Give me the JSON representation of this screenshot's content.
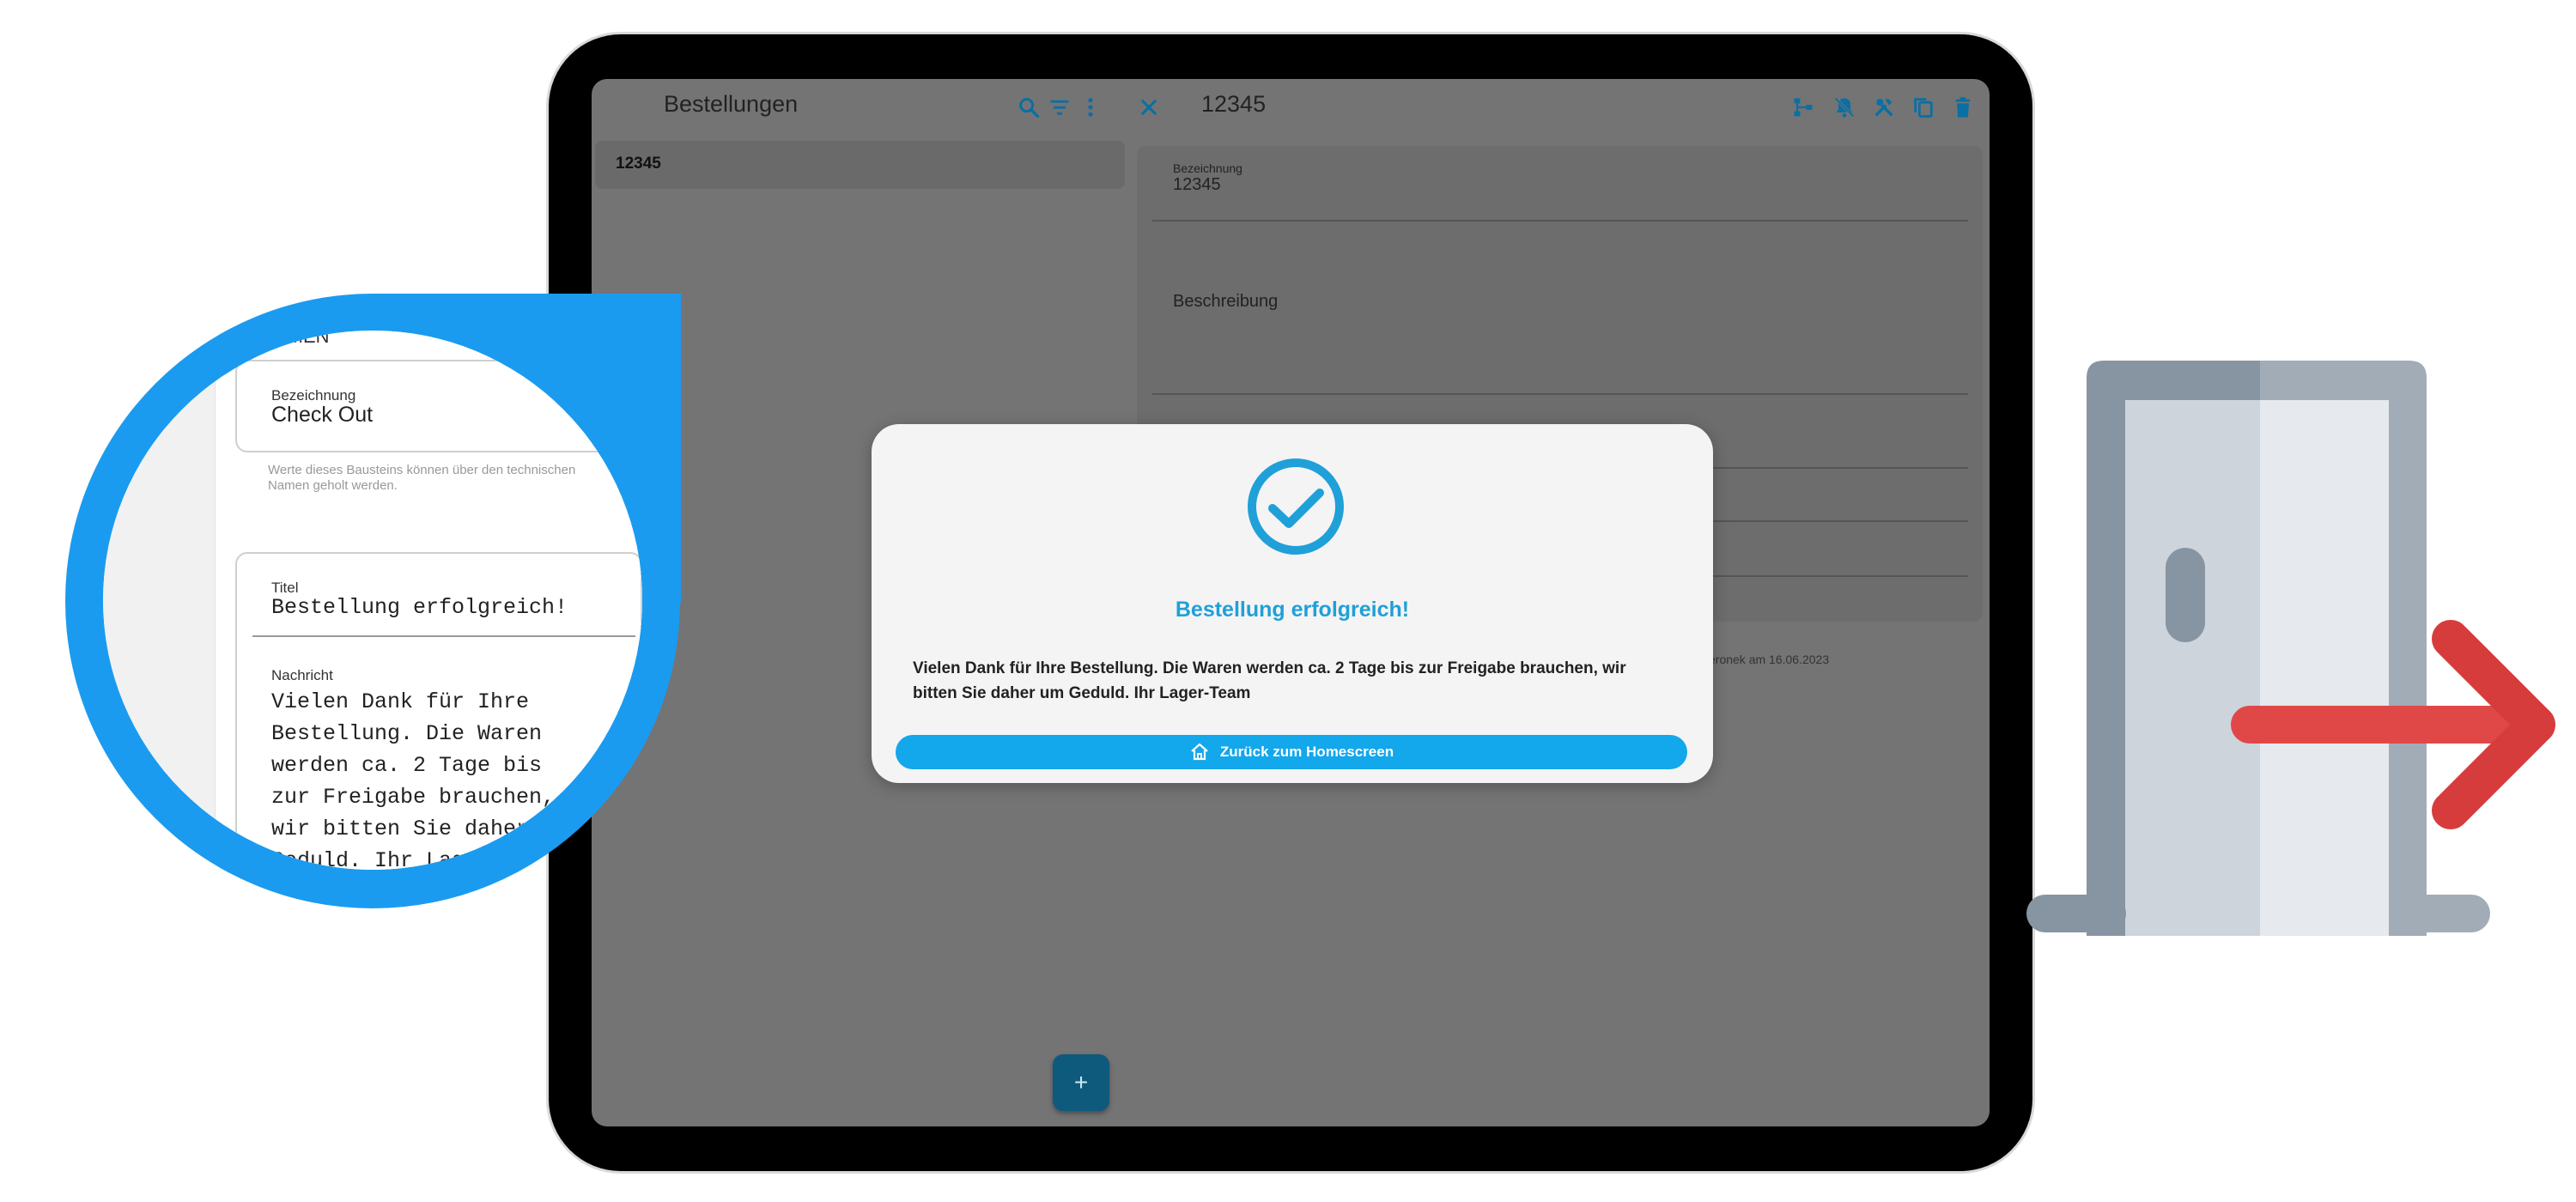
{
  "list": {
    "title": "Bestellungen",
    "items": [
      "12345"
    ]
  },
  "detail": {
    "title": "12345",
    "bezeichnung_label": "Bezeichnung",
    "bezeichnung_value": "12345",
    "beschreibung_label": "Beschreibung",
    "meta_text": "eronek am 16.06.2023"
  },
  "fab": {
    "label": "+"
  },
  "dialog": {
    "title": "Bestellung erfolgreich!",
    "message": "Vielen Dank für Ihre Bestellung. Die Waren werden ca. 2 Tage bis zur Freigabe brauchen, wir bitten Sie daher um Geduld. Ihr Lager-Team",
    "button_label": "Zurück zum Homescreen",
    "button_icon": "home-icon"
  },
  "magnifier": {
    "section_fragment": "AMEN",
    "bezeichnung_label": "Bezeichnung",
    "bezeichnung_value": "Check Out",
    "help_text": "Werte dieses Bausteins können über den technischen Namen geholt werden.",
    "titel_label": "Titel",
    "titel_value": "Bestellung erfolgreich!",
    "nachricht_label": "Nachricht",
    "nachricht_lines": [
      "Vielen Dank für Ihre",
      "Bestellung. Die Waren",
      "werden ca. 2 Tage bis",
      "zur Freigabe brauchen,",
      "wir bitten Sie daher",
      "Geduld. Ihr Lag"
    ]
  },
  "icons": {
    "toolbar_left": [
      "search-icon",
      "filter-icon",
      "more-vert-icon"
    ],
    "toolbar_right": [
      "hierarchy-icon",
      "notifications-off-icon",
      "tools-icon",
      "copy-icon",
      "delete-icon"
    ],
    "exit": "exit-door-icon"
  },
  "colors": {
    "accent": "#1fa0d8",
    "button": "#13a7ec",
    "magnifier": "#1a9bf0",
    "exit_arrow": "#e04848"
  }
}
